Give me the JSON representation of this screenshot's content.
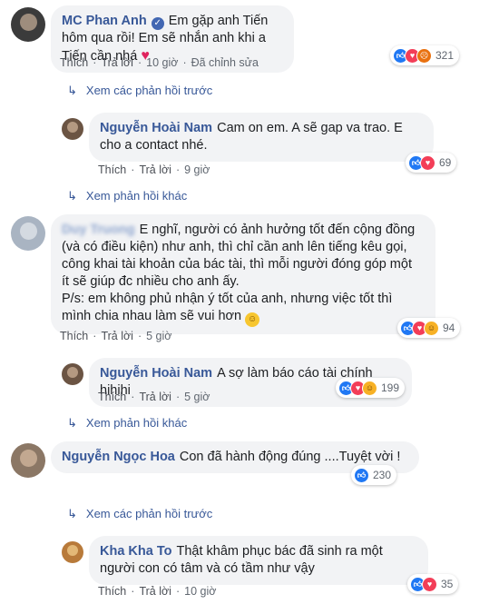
{
  "comments": [
    {
      "author": "MC Phan Anh",
      "text": "Em gặp anh Tiến hôm qua rồi! Em sẽ nhắn anh khi a Tiến cần nhá",
      "actions": {
        "like": "Thích",
        "reply": "Trả lời",
        "time": "10 giờ",
        "edited": "Đã chỉnh sửa"
      },
      "reaction_count": "321"
    },
    {
      "author": "Nguyễn Hoài Nam",
      "text": "Cam on em. A sẽ gap va trao. E cho a contact nhé.",
      "actions": {
        "like": "Thích",
        "reply": "Trả lời",
        "time": "9 giờ"
      },
      "reaction_count": "69"
    },
    {
      "author": "Duy Truong",
      "text": "E nghĩ, người có ảnh hưởng tốt đến cộng đồng (và có điều kiện) như anh, thì chỉ cần anh lên tiếng kêu gọi, công khai tài khoản của bác tài, thì mỗi người đóng góp một ít sẽ giúp đc nhiều cho anh ấy.",
      "text2": "P/s: em không phủ nhận ý tốt của anh, nhưng việc tốt thì mình chia nhau làm sẽ vui hơn",
      "actions": {
        "like": "Thích",
        "reply": "Trả lời",
        "time": "5 giờ"
      },
      "reaction_count": "94"
    },
    {
      "author": "Nguyễn Hoài Nam",
      "text": "A sợ làm báo cáo tài chính hihihi",
      "actions": {
        "like": "Thích",
        "reply": "Trả lời",
        "time": "5 giờ"
      },
      "reaction_count": "199"
    },
    {
      "author": "Nguyễn Ngọc Hoa",
      "text": "Con đã hành động đúng ....Tuyệt vời !",
      "reaction_count": "230"
    },
    {
      "author": "Kha Kha To",
      "text": "Thật khâm phục bác đã sinh ra một người con có tâm và có tầm như vậy",
      "actions": {
        "like": "Thích",
        "reply": "Trả lời",
        "time": "10 giờ"
      },
      "reaction_count": "35"
    }
  ],
  "links": {
    "prev_replies_1": "Xem các phản hồi trước",
    "other_replies_1": "Xem phản hồi khác",
    "other_replies_2": "Xem phản hồi khác",
    "prev_replies_2": "Xem các phản hồi trước"
  },
  "colors": {
    "author": "#385898",
    "bubble": "#f2f3f5",
    "like": "#2078f4",
    "love": "#f33e58"
  }
}
